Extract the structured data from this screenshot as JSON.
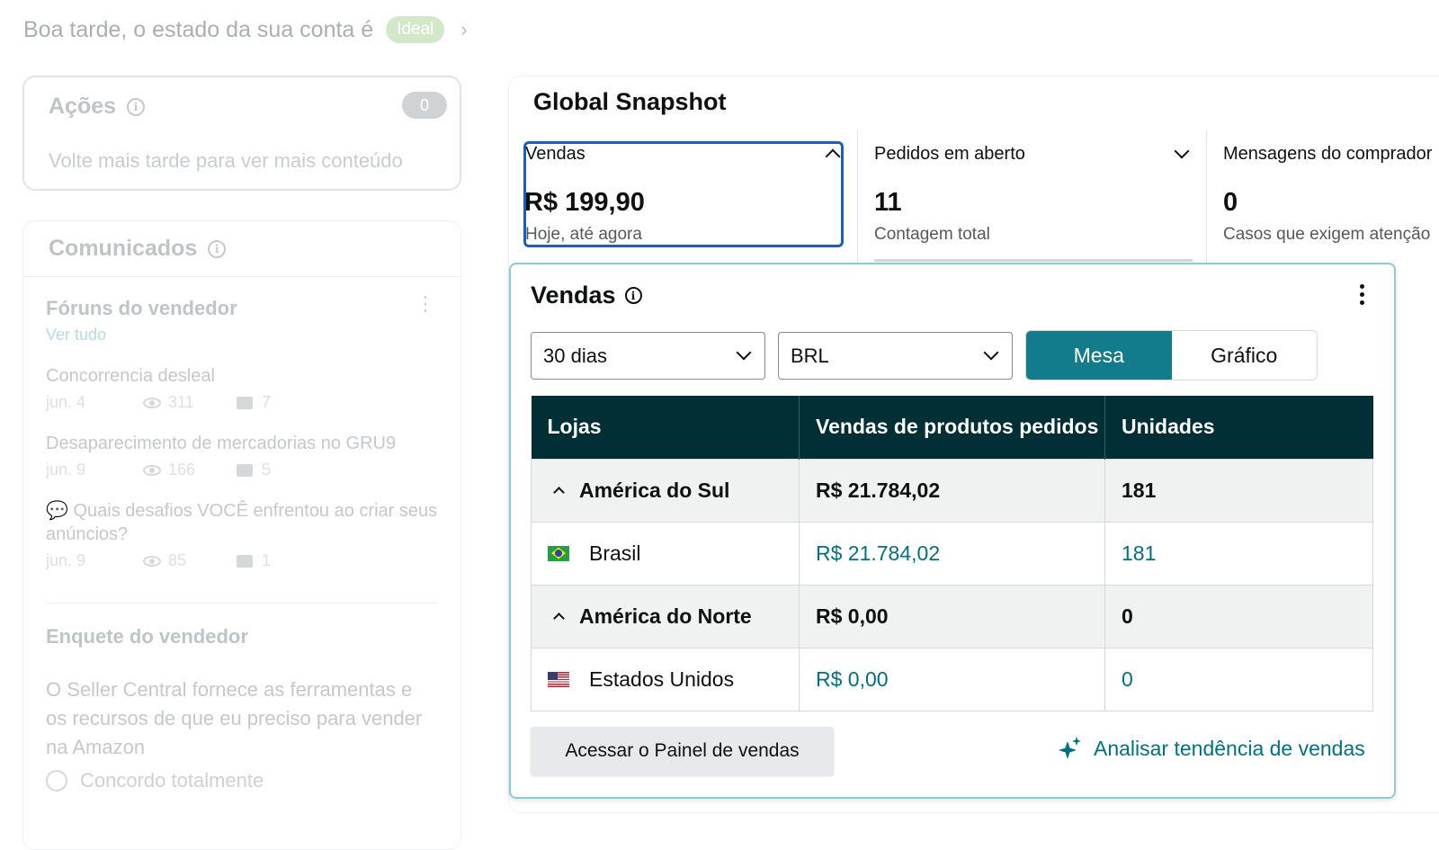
{
  "greeting": {
    "text": "Boa tarde, o estado da sua conta é",
    "status_badge": "Ideal"
  },
  "actions": {
    "title": "Ações",
    "count": "0",
    "empty_message": "Volte mais tarde para ver mais conteúdo"
  },
  "announcements": {
    "title": "Comunicados",
    "forums": {
      "title": "Fóruns do vendedor",
      "view_all": "Ver tudo",
      "posts": [
        {
          "title": "Concorrencia desleal",
          "date": "jun. 4",
          "views": "311",
          "comments": "7"
        },
        {
          "title": "Desaparecimento de mercadorias no GRU9",
          "date": "jun. 9",
          "views": "166",
          "comments": "5"
        },
        {
          "title": "💬 Quais desafios VOCÊ enfrentou ao criar seus anúncios?",
          "date": "jun. 9",
          "views": "85",
          "comments": "1"
        }
      ]
    },
    "poll": {
      "title": "Enquete do vendedor",
      "question": "O Seller Central fornece as ferramentas e os recursos de que eu preciso para vender na Amazon",
      "option_1": "Concordo totalmente"
    }
  },
  "snapshot": {
    "title": "Global Snapshot",
    "tiles": [
      {
        "label": "Vendas",
        "value": "R$ 199,90",
        "sub": "Hoje, até agora"
      },
      {
        "label": "Pedidos em aberto",
        "value": "11",
        "sub": "Contagem total"
      },
      {
        "label": "Mensagens do comprador",
        "value": "0",
        "sub": "Casos que exigem atenção"
      }
    ]
  },
  "sales_panel": {
    "title": "Vendas",
    "period_select": "30 dias",
    "currency_select": "BRL",
    "view_toggle": {
      "table": "Mesa",
      "chart": "Gráfico",
      "active": "table"
    },
    "table": {
      "headers": [
        "Lojas",
        "Vendas de produtos pedidos",
        "Unidades"
      ],
      "rows": [
        {
          "type": "region",
          "name": "América do Sul",
          "sales": "R$ 21.784,02",
          "units": "181"
        },
        {
          "type": "country",
          "flag": "brazil-flag",
          "name": "Brasil",
          "sales": "R$ 21.784,02",
          "units": "181"
        },
        {
          "type": "region",
          "name": "América do Norte",
          "sales": "R$ 0,00",
          "units": "0"
        },
        {
          "type": "country",
          "flag": "us-flag",
          "name": "Estados Unidos",
          "sales": "R$ 0,00",
          "units": "0"
        }
      ]
    },
    "dashboard_button": "Acessar o Painel de vendas",
    "trend_link": "Analisar tendência de vendas"
  },
  "colors": {
    "accent_teal": "#137c8c",
    "table_header": "#002f36",
    "link": "#007185",
    "focus_border": "#1d5fb3"
  }
}
